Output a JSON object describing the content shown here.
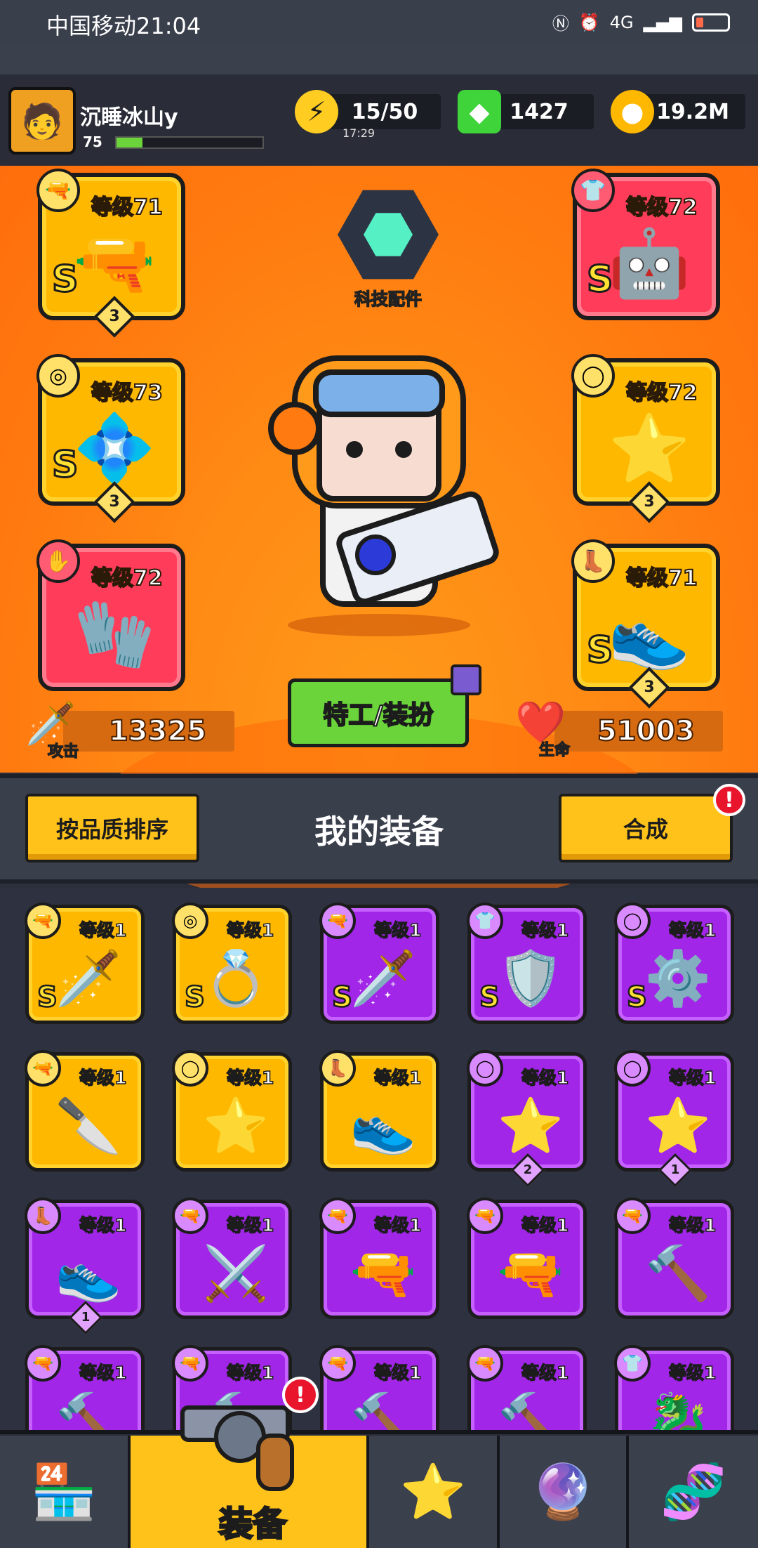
{
  "status_bar": {
    "carrier_time": "中国移动21:04",
    "right_icons": [
      "nfc-icon",
      "alarm-icon",
      "signal-icon",
      "battery-icon"
    ],
    "network": "4G"
  },
  "player": {
    "name": "沉睡冰山y",
    "level": "75",
    "xp_fraction": 0.18
  },
  "resources": {
    "energy": {
      "value": "15/50",
      "timer": "17:29",
      "icon": "lightning-icon",
      "color": "#ffcc22"
    },
    "gems": {
      "value": "1427",
      "icon": "green-gem-icon",
      "color": "#3ed43a"
    },
    "coins": {
      "value": "19.2M",
      "icon": "coin-icon",
      "color": "#ffb800"
    }
  },
  "equipped": [
    {
      "slot": "weapon",
      "icon": "weapon-icon",
      "level": "等级71",
      "grade": "S",
      "stars": "3",
      "rarity": "gold",
      "art": "laser-gun"
    },
    {
      "slot": "necklace",
      "icon": "necklace-icon",
      "level": "等级73",
      "grade": "S",
      "stars": "3",
      "rarity": "gold",
      "art": "star-necklace"
    },
    {
      "slot": "glove",
      "icon": "glove-icon",
      "level": "等级72",
      "grade": "",
      "stars": "",
      "rarity": "red",
      "art": "metal-glove"
    },
    {
      "slot": "armor",
      "icon": "armor-icon",
      "level": "等级72",
      "grade": "S",
      "stars": "",
      "rarity": "red",
      "art": "mech-armor"
    },
    {
      "slot": "belt",
      "icon": "belt-icon",
      "level": "等级72",
      "grade": "",
      "stars": "3",
      "rarity": "gold",
      "art": "star-belt"
    },
    {
      "slot": "boots",
      "icon": "boots-icon",
      "level": "等级71",
      "grade": "S",
      "stars": "3",
      "rarity": "gold",
      "art": "mech-boots"
    }
  ],
  "tech_parts": {
    "label": "科技配件"
  },
  "costume_button": {
    "label": "特工/装扮"
  },
  "stats": {
    "attack_label": "攻击",
    "attack": "13325",
    "hp_label": "生命",
    "hp": "51003"
  },
  "toolbar": {
    "sort_label": "按品质排序",
    "title": "我的装备",
    "merge_label": "合成",
    "merge_alert": "!"
  },
  "inventory": [
    {
      "level": "等级1",
      "icon": "weapon-icon",
      "rarity": "gold",
      "grade": "S",
      "stars": "",
      "art": "🗡️"
    },
    {
      "level": "等级1",
      "icon": "necklace-icon",
      "rarity": "gold",
      "grade": "S",
      "stars": "",
      "art": "💍"
    },
    {
      "level": "等级1",
      "icon": "weapon-icon",
      "rarity": "purple",
      "grade": "S",
      "stars": "",
      "art": "🗡️"
    },
    {
      "level": "等级1",
      "icon": "armor-icon",
      "rarity": "purple",
      "grade": "S",
      "stars": "",
      "art": "🛡️"
    },
    {
      "level": "等级1",
      "icon": "belt-icon",
      "rarity": "purple",
      "grade": "S",
      "stars": "",
      "art": "⚙️"
    },
    {
      "level": "等级1",
      "icon": "weapon-icon",
      "rarity": "gold",
      "grade": "",
      "stars": "",
      "art": "🔪"
    },
    {
      "level": "等级1",
      "icon": "belt-icon",
      "rarity": "gold",
      "grade": "",
      "stars": "",
      "art": "⭐"
    },
    {
      "level": "等级1",
      "icon": "boots-icon",
      "rarity": "gold",
      "grade": "",
      "stars": "",
      "art": "👟"
    },
    {
      "level": "等级1",
      "icon": "belt-icon",
      "rarity": "purple",
      "grade": "",
      "stars": "2",
      "art": "⭐"
    },
    {
      "level": "等级1",
      "icon": "belt-icon",
      "rarity": "purple",
      "grade": "",
      "stars": "1",
      "art": "⭐"
    },
    {
      "level": "等级1",
      "icon": "boots-icon",
      "rarity": "purple",
      "grade": "",
      "stars": "1",
      "art": "👟"
    },
    {
      "level": "等级1",
      "icon": "weapon-icon",
      "rarity": "purple",
      "grade": "",
      "stars": "",
      "art": "⚔️"
    },
    {
      "level": "等级1",
      "icon": "weapon-icon",
      "rarity": "purple",
      "grade": "",
      "stars": "",
      "art": "🔫"
    },
    {
      "level": "等级1",
      "icon": "weapon-icon",
      "rarity": "purple",
      "grade": "",
      "stars": "",
      "art": "🔫"
    },
    {
      "level": "等级1",
      "icon": "weapon-icon",
      "rarity": "purple",
      "grade": "",
      "stars": "",
      "art": "🔨"
    },
    {
      "level": "等级1",
      "icon": "weapon-icon",
      "rarity": "purple",
      "grade": "",
      "stars": "",
      "art": "🔨"
    },
    {
      "level": "等级1",
      "icon": "weapon-icon",
      "rarity": "purple",
      "grade": "",
      "stars": "",
      "art": "🔨"
    },
    {
      "level": "等级1",
      "icon": "weapon-icon",
      "rarity": "purple",
      "grade": "",
      "stars": "",
      "art": "🔨"
    },
    {
      "level": "等级1",
      "icon": "weapon-icon",
      "rarity": "purple",
      "grade": "",
      "stars": "",
      "art": "🔨"
    },
    {
      "level": "等级1",
      "icon": "armor-icon",
      "rarity": "purple",
      "grade": "",
      "stars": "",
      "art": "🐉"
    }
  ],
  "bottom_nav": {
    "tabs": [
      {
        "name": "shop",
        "icon": "shop-icon"
      },
      {
        "name": "equipment",
        "icon": "revolver-icon",
        "label": "装备",
        "active": true,
        "alert": "!"
      },
      {
        "name": "arena",
        "icon": "crossed-swords-star-icon"
      },
      {
        "name": "events",
        "icon": "stars-ball-icon"
      },
      {
        "name": "evolve",
        "icon": "dna-capsule-icon"
      }
    ]
  }
}
